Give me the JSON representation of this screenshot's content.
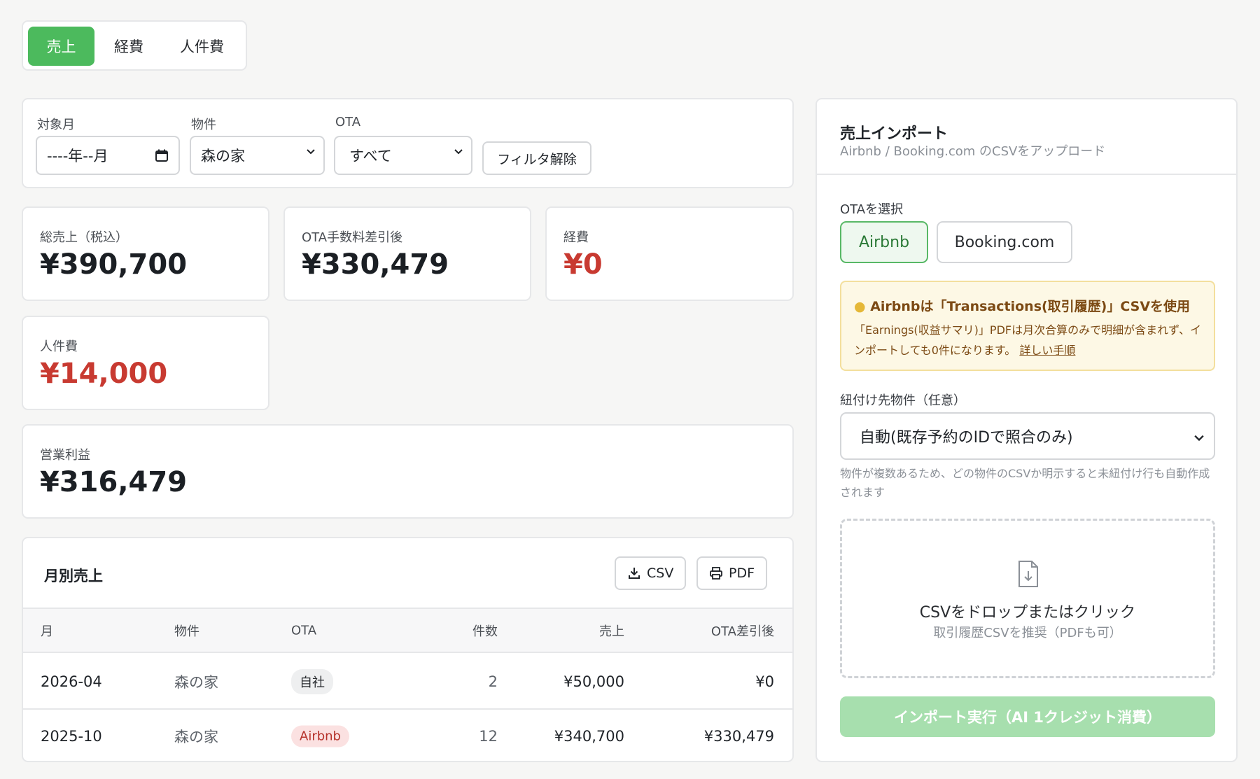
{
  "tabs": [
    "売上",
    "経費",
    "人件費"
  ],
  "filters": {
    "month_label": "対象月",
    "month_value": "----年--月",
    "property_label": "物件",
    "property_value": "森の家",
    "ota_label": "OTA",
    "ota_value": "すべて",
    "clear_label": "フィルタ解除"
  },
  "stats": {
    "total_sales": {
      "label": "総売上（税込）",
      "value": "¥390,700"
    },
    "after_ota": {
      "label": "OTA手数料差引後",
      "value": "¥330,479"
    },
    "expenses": {
      "label": "経費",
      "value": "¥0"
    },
    "labor": {
      "label": "人件費",
      "value": "¥14,000"
    },
    "operating_profit": {
      "label": "営業利益",
      "value": "¥316,479"
    }
  },
  "monthly": {
    "title": "月別売上",
    "csv_label": "CSV",
    "pdf_label": "PDF",
    "columns": [
      "月",
      "物件",
      "OTA",
      "件数",
      "売上",
      "OTA差引後"
    ],
    "rows": [
      {
        "month": "2026-04",
        "property": "森の家",
        "ota": "自社",
        "count": "2",
        "sales": "¥50,000",
        "net": "¥0"
      },
      {
        "month": "2025-10",
        "property": "森の家",
        "ota": "Airbnb",
        "count": "12",
        "sales": "¥340,700",
        "net": "¥330,479"
      }
    ]
  },
  "import": {
    "title": "売上インポート",
    "subtitle": "Airbnb / Booking.com のCSVをアップロード",
    "ota_select_label": "OTAを選択",
    "ota_options": [
      "Airbnb",
      "Booking.com"
    ],
    "tip_title": "Airbnbは「Transactions(取引履歴)」CSVを使用",
    "tip_body": "「Earnings(収益サマリ)」PDFは月次合算のみで明細が含まれず、インポートしても0件になります。",
    "tip_link": "詳しい手順",
    "link_property_label": "紐付け先物件（任意）",
    "link_property_value": "自動(既存予約のIDで照合のみ)",
    "hint": "物件が複数あるため、どの物件のCSVか明示すると未紐付け行も自動作成されます",
    "drop_title": "CSVをドロップまたはクリック",
    "drop_sub": "取引履歴CSVを推奨（PDFも可）",
    "run_label": "インポート実行（AI 1クレジット消費）"
  },
  "colors": {
    "accent": "#4cba5d",
    "negative": "#c83a31",
    "run_disabled": "#a7dfae"
  }
}
